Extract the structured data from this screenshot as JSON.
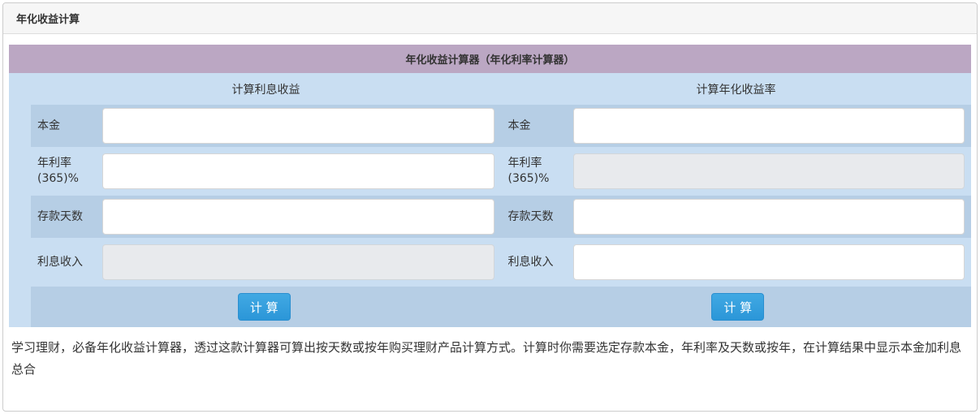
{
  "panel": {
    "title": "年化收益计算"
  },
  "calculator": {
    "title": "年化收益计算器（年化利率计算器）",
    "column_headers": {
      "left": "计算利息收益",
      "right": "计算年化收益率"
    },
    "rows": [
      {
        "label": "本金"
      },
      {
        "label": "年利率\n(365)%"
      },
      {
        "label": "存款天数"
      },
      {
        "label": "利息收入"
      }
    ],
    "button_label": "计 算"
  },
  "description": "学习理财，必备年化收益计算器，透过这款计算器可算出按天数或按年购买理财产品计算方式。计算时你需要选定存款本金，年利率及天数或按年，在计算结果中显示本金加利息总合",
  "colors": {
    "header_purple": "#bba7c3",
    "table_bg": "#c9def2",
    "row_dark": "#b6cee5",
    "button_blue": "#339fdd",
    "disabled_bg": "#e8eaed"
  }
}
